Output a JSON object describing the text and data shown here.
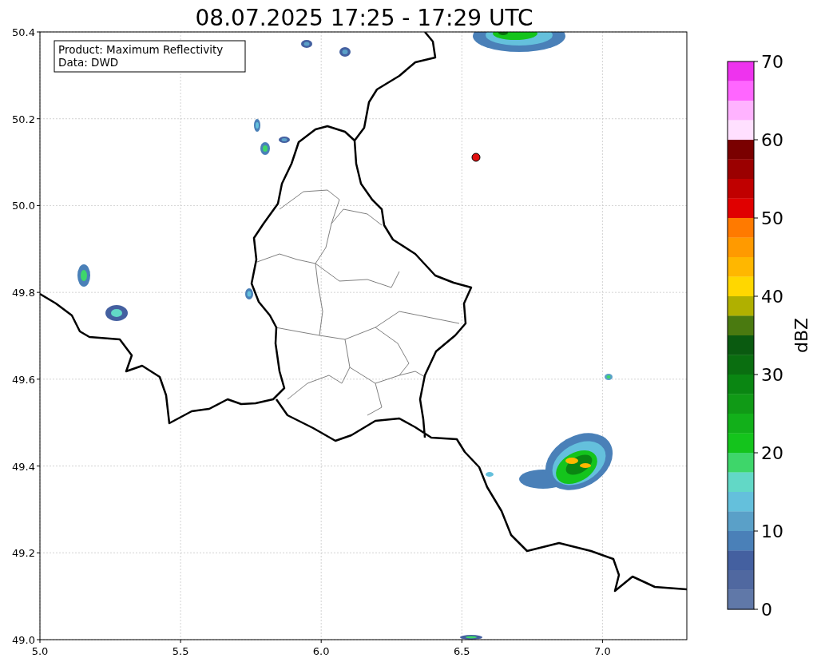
{
  "title": "08.07.2025 17:25 - 17:29 UTC",
  "info_box": {
    "lines": [
      "Product: Maximum Reflectivity",
      "Data: DWD"
    ]
  },
  "map": {
    "x_ticks": [
      "5.0",
      "5.5",
      "6.0",
      "6.5",
      "7.0"
    ],
    "y_ticks": [
      "50.4",
      "50.2",
      "50.0",
      "49.8",
      "49.6",
      "49.4",
      "49.2",
      "49.0"
    ]
  },
  "colorbar": {
    "label": "dBZ",
    "ticks": [
      "70",
      "60",
      "50",
      "40",
      "30",
      "20",
      "10",
      "0"
    ],
    "segments": [
      {
        "color": "#ee33ee"
      },
      {
        "color": "#ff66ff"
      },
      {
        "color": "#ffb3ff"
      },
      {
        "color": "#ffe0ff"
      },
      {
        "color": "#7a0000"
      },
      {
        "color": "#9b0000"
      },
      {
        "color": "#c00000"
      },
      {
        "color": "#e00000"
      },
      {
        "color": "#ff7a00"
      },
      {
        "color": "#ff9a00"
      },
      {
        "color": "#ffb700"
      },
      {
        "color": "#ffd700"
      },
      {
        "color": "#b0b000"
      },
      {
        "color": "#4a7a10"
      },
      {
        "color": "#0a5a10"
      },
      {
        "color": "#0a6e10"
      },
      {
        "color": "#0a8612"
      },
      {
        "color": "#109a16"
      },
      {
        "color": "#12b01a"
      },
      {
        "color": "#14c41c"
      },
      {
        "color": "#3ed66a"
      },
      {
        "color": "#62d8c6"
      },
      {
        "color": "#64c0dc"
      },
      {
        "color": "#5aa0c8"
      },
      {
        "color": "#4a80b8"
      },
      {
        "color": "#4460a0"
      },
      {
        "color": "#5068a0"
      },
      {
        "color": "#6078a8"
      }
    ]
  }
}
